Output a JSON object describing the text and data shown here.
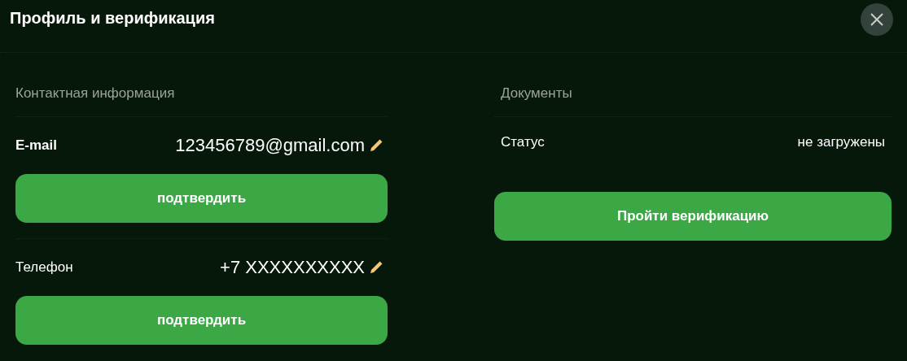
{
  "window": {
    "title": "Профиль и верификация"
  },
  "contacts": {
    "heading": "Контактная информация",
    "items": [
      {
        "label": "E-mail",
        "value": "123456789@gmail.com",
        "bold_label": true,
        "button": "подтвердить"
      },
      {
        "label": "Телефон",
        "value": "+7 XXXXXXXXXX",
        "bold_label": false,
        "button": "подтвердить"
      }
    ]
  },
  "documents": {
    "heading": "Документы",
    "status_label": "Статус",
    "status_value": "не загружены",
    "button": "Пройти верификацию"
  }
}
